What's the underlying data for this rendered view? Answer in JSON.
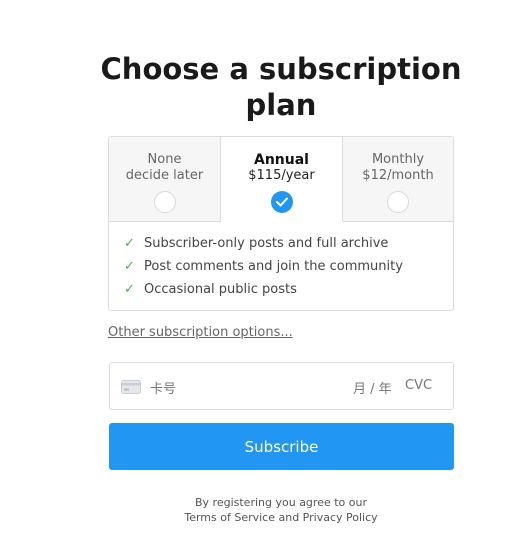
{
  "page": {
    "title": "Choose a subscription plan"
  },
  "plans": [
    {
      "name": "None",
      "price": "decide later",
      "selected": false
    },
    {
      "name": "Annual",
      "price": "$115/year",
      "selected": true
    },
    {
      "name": "Monthly",
      "price": "$12/month",
      "selected": false
    }
  ],
  "features": [
    "Subscriber-only posts and full archive",
    "Post comments and join the community",
    "Occasional public posts"
  ],
  "other_options_label": "Other subscription options...",
  "card": {
    "number_placeholder": "卡号",
    "expiry_placeholder": "月 / 年",
    "cvc_placeholder": "CVC",
    "icon": "credit-card-icon"
  },
  "subscribe_label": "Subscribe",
  "legal": {
    "line1": "By registering you agree to our",
    "line2": "Terms of Service and Privacy Policy"
  },
  "colors": {
    "accent": "#2196f3",
    "check": "#4caf50"
  }
}
